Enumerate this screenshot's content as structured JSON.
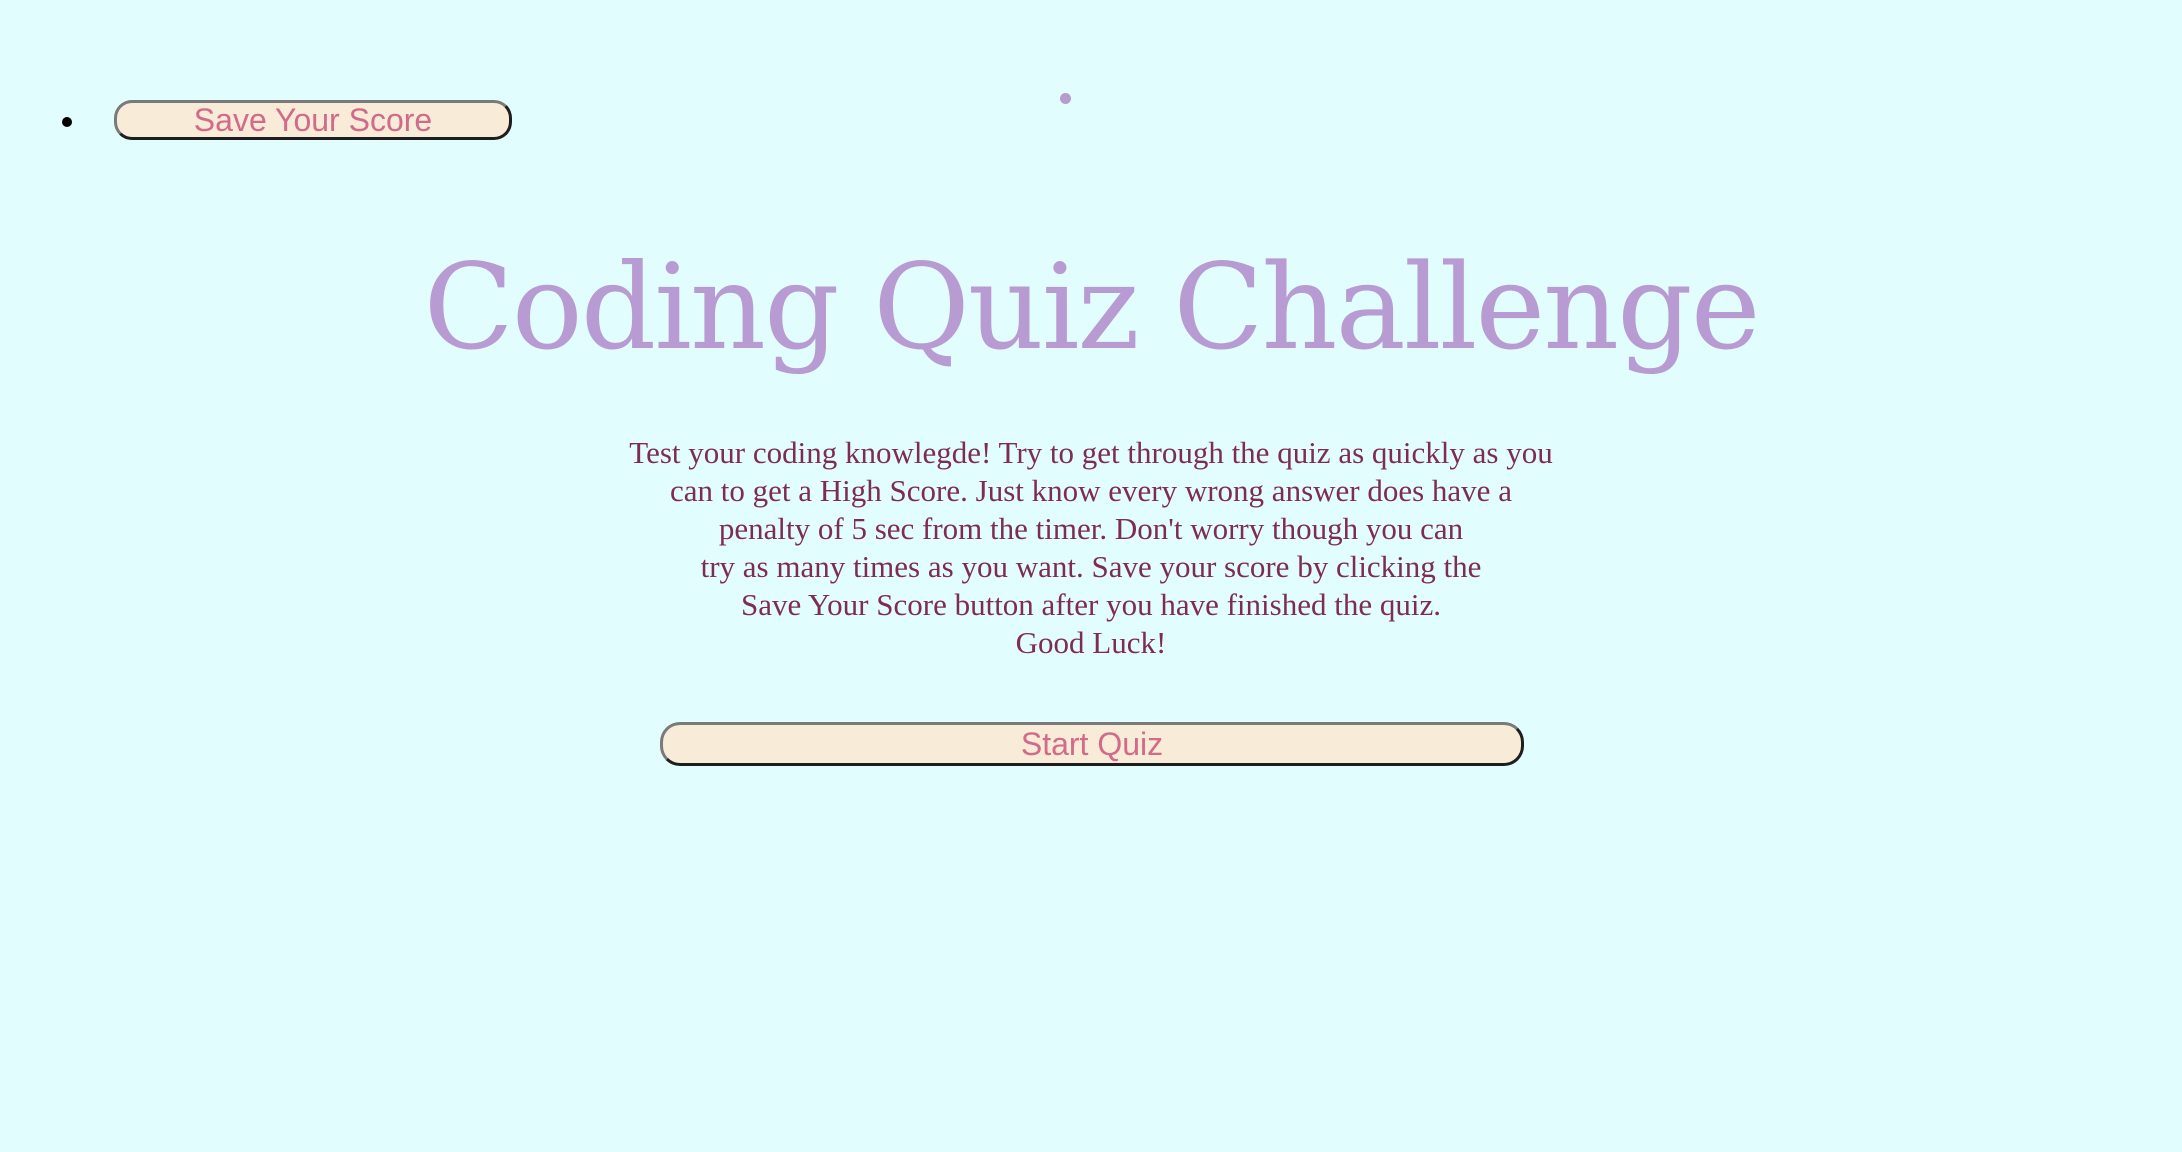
{
  "nav": {
    "save_score_label": "Save Your Score"
  },
  "main": {
    "title": "Coding Quiz Challenge",
    "intro_lines": [
      "Test your coding knowlegde! Try to get through the quiz as quickly as you",
      "can to get a High Score. Just know every wrong answer does have a",
      "penalty of 5 sec from the timer. Don't worry though you can",
      "try as many times as you want. Save your score by clicking the",
      "Save Your Score button after you have finished the quiz.",
      "Good Luck!"
    ],
    "start_label": "Start Quiz"
  },
  "colors": {
    "background": "#e2fdfd",
    "title": "#b89bd2",
    "body_text": "#7e2c53",
    "button_bg": "#f8ebd8",
    "button_text": "#d26a8a"
  }
}
